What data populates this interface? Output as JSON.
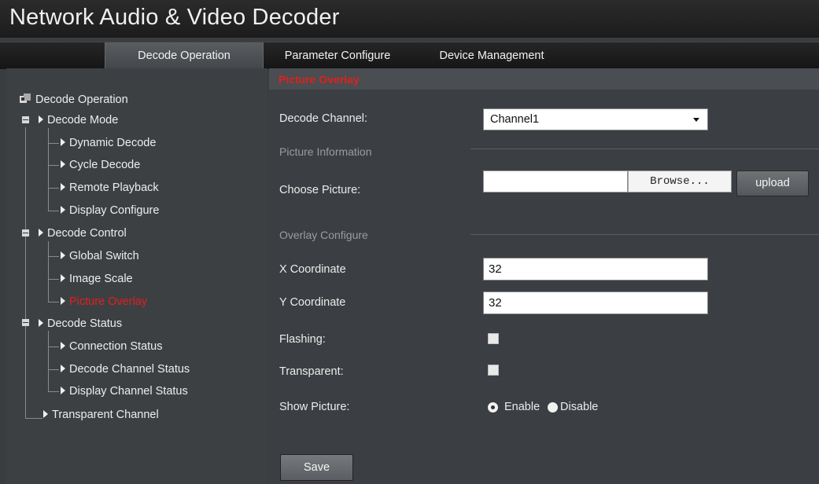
{
  "app": {
    "title": "Network Audio & Video Decoder"
  },
  "nav": {
    "tabs": [
      {
        "label": "Decode Operation",
        "active": true
      },
      {
        "label": "Parameter Configure",
        "active": false
      },
      {
        "label": "Device Management",
        "active": false
      }
    ]
  },
  "sidebar": {
    "root": {
      "label": "Decode Operation",
      "icon": "decoder-icon"
    },
    "groups": [
      {
        "label": "Decode Mode",
        "children": [
          "Dynamic Decode",
          "Cycle Decode",
          "Remote Playback",
          "Display Configure"
        ]
      },
      {
        "label": "Decode Control",
        "children": [
          "Global Switch",
          "Image Scale",
          "Picture Overlay"
        ]
      },
      {
        "label": "Decode Status",
        "children": [
          "Connection Status",
          "Decode Channel Status",
          "Display Channel Status"
        ]
      }
    ],
    "extra": "Transparent Channel",
    "active_item": "Picture Overlay"
  },
  "main": {
    "section_title": "Picture Overlay",
    "decode_channel": {
      "label": "Decode Channel:",
      "value": "Channel1"
    },
    "picture_info_header": "Picture Information",
    "choose_picture": {
      "label": "Choose Picture:",
      "browse_label": "Browse...",
      "upload_label": "upload"
    },
    "overlay_header": "Overlay Configure",
    "x_coord": {
      "label": "X Coordinate",
      "value": "32"
    },
    "y_coord": {
      "label": "Y Coordinate",
      "value": "32"
    },
    "flashing": {
      "label": "Flashing:",
      "checked": false
    },
    "transparent": {
      "label": "Transparent:",
      "checked": false
    },
    "show_picture": {
      "label": "Show Picture:",
      "enable_label": "Enable",
      "disable_label": "Disable",
      "selected": "Enable"
    },
    "save_label": "Save"
  },
  "colors": {
    "accent_red": "#e0201c",
    "background": "#3a3d40"
  }
}
